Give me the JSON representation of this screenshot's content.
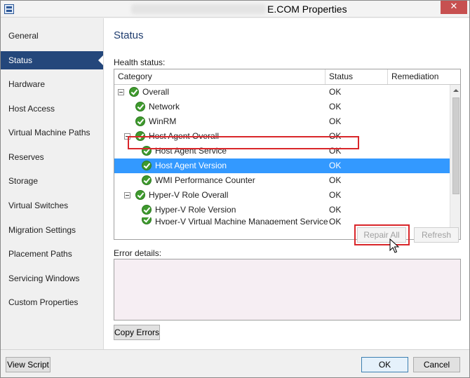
{
  "window": {
    "title": "E.COM Properties",
    "close_icon": "close-icon"
  },
  "sidebar": {
    "items": [
      {
        "label": "General"
      },
      {
        "label": "Status",
        "active": true
      },
      {
        "label": "Hardware"
      },
      {
        "label": "Host Access"
      },
      {
        "label": "Virtual Machine Paths"
      },
      {
        "label": "Reserves"
      },
      {
        "label": "Storage"
      },
      {
        "label": "Virtual Switches"
      },
      {
        "label": "Migration Settings"
      },
      {
        "label": "Placement Paths"
      },
      {
        "label": "Servicing Windows"
      },
      {
        "label": "Custom Properties"
      }
    ]
  },
  "main": {
    "title": "Status",
    "health_label": "Health status:",
    "columns": {
      "category": "Category",
      "status": "Status",
      "remediation": "Remediation"
    },
    "rows": [
      {
        "name": "Overall",
        "status": "OK",
        "expander": true
      },
      {
        "name": "Network",
        "status": "OK"
      },
      {
        "name": "WinRM",
        "status": "OK"
      },
      {
        "name": "Host Agent Overall",
        "status": "OK",
        "expander": true
      },
      {
        "name": "Host Agent Service",
        "status": "OK"
      },
      {
        "name": "Host Agent Version",
        "status": "OK",
        "selected": true
      },
      {
        "name": "WMI Performance Counter",
        "status": "OK"
      },
      {
        "name": "Hyper-V Role Overall",
        "status": "OK",
        "expander": true
      },
      {
        "name": "Hyper-V Role Version",
        "status": "OK"
      },
      {
        "name": "Hyper-V Virtual Machine Management Service",
        "status": "OK"
      }
    ],
    "repair_all_label": "Repair All",
    "refresh_label": "Refresh",
    "error_details_label": "Error details:",
    "copy_errors_label": "Copy Errors"
  },
  "footer": {
    "view_script_label": "View Script",
    "ok_label": "OK",
    "cancel_label": "Cancel"
  },
  "colors": {
    "nav_active": "#24477b",
    "selection": "#3399ff",
    "status_ok": "#3f9a2e",
    "annotation": "#d9262a"
  }
}
